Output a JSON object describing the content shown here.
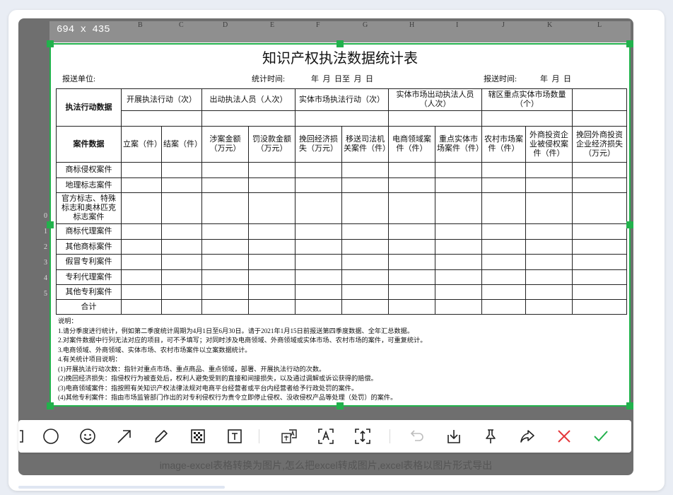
{
  "screenshot": {
    "dimension_label": "694 x 435",
    "column_letters": [
      "B",
      "C",
      "D",
      "E",
      "F",
      "G",
      "H",
      "I",
      "J",
      "K",
      "L"
    ],
    "row_numbers": [
      "0",
      "1",
      "2",
      "3",
      "4",
      "5"
    ],
    "caption": "image-excel表格转换为图片,怎么把excel转成图片,excel表格以图片形式导出"
  },
  "sheet": {
    "title": "知识产权执法数据统计表",
    "unit_label": "报送单位:",
    "period_label": "统计时间:",
    "period_value": "年  月  日至  月  日",
    "submit_label": "报送时间:",
    "submit_value": "年  月  日",
    "header": {
      "row_label": "执法行动数据",
      "groups": [
        "开展执法行动（次）",
        "出动执法人员（人次）",
        "实体市场执法行动（次）",
        "实体市场出动执法人员（人次）",
        "辖区重点实体市场数量（个）"
      ],
      "case_label": "案件数据",
      "columns": [
        "立案（件）",
        "结案（件）",
        "涉案金额（万元）",
        "罚没款金额（万元）",
        "挽回经济损失（万元）",
        "移送司法机关案件（件）",
        "电商领域案件（件）",
        "重点实体市场案件（件）",
        "农村市场案件（件）",
        "外商投资企业被侵权案件（件）",
        "挽回外商投资企业经济损失（万元）"
      ]
    },
    "rows": [
      "商标侵权案件",
      "地理标志案件",
      "官方标志、特殊标志和奥林匹克标志案件",
      "商标代理案件",
      "其他商标案件",
      "假冒专利案件",
      "专利代理案件",
      "其他专利案件",
      "合计"
    ],
    "notes": [
      "说明：",
      "1.请分季度进行统计，例如第二季度统计周期为4月1日至6月30日。请于2021年1月15日前报送第四季度数据、全年汇总数据。",
      "2.对案件数据中行列无法对应的项目，可不予填写；对同时涉及电商领域、外商领域或实体市场、农村市场的案件，可重复统计。",
      "3.电商领域、外商领域、实体市场、农村市场案件以立案数据统计。",
      "4.有关统计项目说明：",
      "(1)开展执法行动次数：指针对重点市场、重点商品、重点领域，部署、开展执法行动的次数。",
      "(2)挽回经济损失：指侵权行为被查处后，权利人避免受到的直接和间接损失，以及通过调解或诉讼获得的赔偿。",
      "(3)电商领域案件：指按照有关知识产权法律法规对电商平台经营者或平台内经营者给予行政处罚的案件。",
      "(4)其他专利案件：指由市场监管部门作出的对专利侵权行为责令立即停止侵权、没收侵权产品等处理（处罚）的案件。"
    ]
  },
  "toolbar": {
    "tools": [
      "rectangle-tool",
      "ellipse-tool",
      "emoji-tool",
      "arrow-tool",
      "pen-tool",
      "mosaic-tool",
      "text-tool",
      "translate-tool",
      "ocr-tool",
      "long-screenshot-tool",
      "undo",
      "download",
      "pin",
      "share",
      "cancel",
      "confirm"
    ]
  },
  "colors": {
    "selection": "#22b14c",
    "cancel": "#e5383b",
    "confirm": "#22b14c",
    "overlay": "#6f6f6f"
  }
}
